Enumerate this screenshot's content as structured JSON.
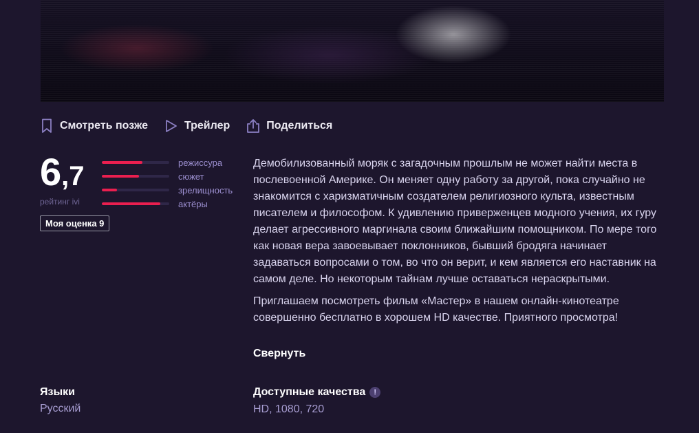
{
  "actions": [
    {
      "label": "Смотреть позже",
      "icon": "bookmark-icon"
    },
    {
      "label": "Трейлер",
      "icon": "play-icon"
    },
    {
      "label": "Поделиться",
      "icon": "share-icon"
    }
  ],
  "rating": {
    "score_int": "6",
    "score_frac": ",7",
    "label": "рейтинг ivi",
    "aspects": [
      {
        "label": "режиссура",
        "value": 0.6
      },
      {
        "label": "сюжет",
        "value": 0.55
      },
      {
        "label": "зрелищность",
        "value": 0.22
      },
      {
        "label": "актёры",
        "value": 0.87
      }
    ],
    "my_rating": "Моя оценка 9",
    "bar_color": "#ea1f4f"
  },
  "description": {
    "paragraphs": [
      "Демобилизованный моряк с загадочным прошлым не может найти места в послевоенной Америке. Он меняет одну работу за другой, пока случайно не знакомится с харизматичным создателем религиозного культа, известным писателем и философом. К удивлению приверженцев модного учения, их гуру делает агрессивного маргинала своим ближайшим помощником. По мере того как новая вера завоевывает поклонников, бывший бродяга начинает задаваться вопросами о том, во что он верит, и кем является его наставник на самом деле. Но некоторым тайнам лучше оставаться нераскрытыми.",
      "Приглашаем посмотреть фильм «Мастер» в нашем онлайн-кинотеатре совершенно бесплатно в хорошем HD качестве. Приятного просмотра!"
    ],
    "collapse_label": "Свернуть"
  },
  "info": {
    "languages_title": "Языки",
    "languages_value": "Русский",
    "quality_title": "Доступные качества",
    "quality_value": "HD, 1080, 720",
    "quality_info_icon": "info-icon"
  },
  "colors": {
    "background": "#1d162d",
    "accent": "#ea1f4f"
  }
}
